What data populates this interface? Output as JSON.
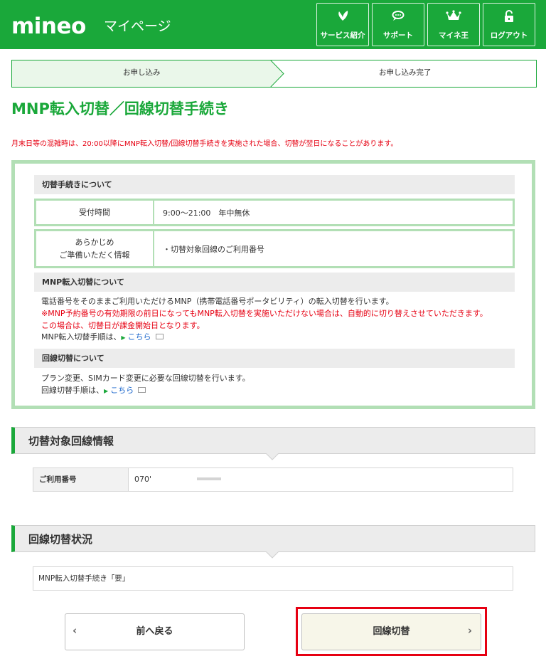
{
  "header": {
    "logo": "mineo",
    "title": "マイページ",
    "nav": [
      {
        "label": "サービス紹介",
        "icon": "leaf-icon"
      },
      {
        "label": "サポート",
        "icon": "chat-icon"
      },
      {
        "label": "マイネ王",
        "icon": "crown-icon"
      },
      {
        "label": "ログアウト",
        "icon": "unlock-icon"
      }
    ]
  },
  "steps": [
    "お申し込み",
    "お申し込み完了"
  ],
  "page_title": "MNP転入切替／回線切替手続き",
  "notice": "月末日等の混雑時は、20:00以降にMNP転入切替/回線切替手続きを実施された場合、切替が翌日になることがあります。",
  "info": {
    "section1_title": "切替手続きについて",
    "hours_label": "受付時間",
    "hours_value": "9:00〜21:00　年中無休",
    "prep_label_1": "あらかじめ",
    "prep_label_2": "ご準備いただく情報",
    "prep_value": "・切替対象回線のご利用番号",
    "section2_title": "MNP転入切替について",
    "mnp_text": "電話番号をそのままご利用いただけるMNP（携帯電話番号ポータビリティ）の転入切替を行います。",
    "mnp_warning_1": "※MNP予約番号の有効期限の前日になってもMNP転入切替を実施いただけない場合は、自動的に切り替えさせていただきます。",
    "mnp_warning_2": "この場合は、切替日が課金開始日となります。",
    "mnp_link_prefix": "MNP転入切替手順は、",
    "mnp_link": "こちら",
    "section3_title": "回線切替について",
    "line_text": "プラン変更、SIMカード変更に必要な回線切替を行います。",
    "line_link_prefix": "回線切替手順は、",
    "line_link": "こちら"
  },
  "target": {
    "heading": "切替対象回線情報",
    "field_label": "ご利用番号",
    "field_value": "070'"
  },
  "status": {
    "heading": "回線切替状況",
    "value": "MNP転入切替手続き「要」"
  },
  "buttons": {
    "back": "前へ戻る",
    "switch": "回線切替"
  },
  "colors": {
    "brand": "#1aa83a",
    "warning": "#e60012",
    "link": "#1a66cc"
  }
}
